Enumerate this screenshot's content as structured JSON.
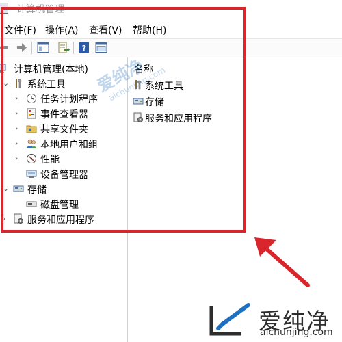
{
  "window": {
    "title": "计算机管理"
  },
  "menubar": {
    "items": [
      "文件(F)",
      "操作(A)",
      "查看(V)",
      "帮助(H)"
    ]
  },
  "toolbar": {
    "icons": [
      "back-arrow-icon",
      "forward-arrow-icon",
      "show-hide-tree-icon",
      "export-list-icon",
      "help-icon",
      "properties-icon"
    ]
  },
  "tree": {
    "root": "计算机管理(本地)",
    "system_tools": "系统工具",
    "task_scheduler": "任务计划程序",
    "event_viewer": "事件查看器",
    "shared_folders": "共享文件夹",
    "local_users": "本地用户和组",
    "performance": "性能",
    "device_manager": "设备管理器",
    "storage": "存储",
    "disk_management": "磁盘管理",
    "services_apps": "服务和应用程序"
  },
  "list": {
    "header": "名称",
    "items": [
      "系统工具",
      "存储",
      "服务和应用程序"
    ]
  },
  "watermark": {
    "text": "爱纯净",
    "sub": "aichunjing.com"
  },
  "logo": {
    "text": "爱纯净",
    "sub": "aichunjing.com"
  },
  "colors": {
    "highlight": "#d9262c",
    "watermark": "#1e6fbf"
  }
}
